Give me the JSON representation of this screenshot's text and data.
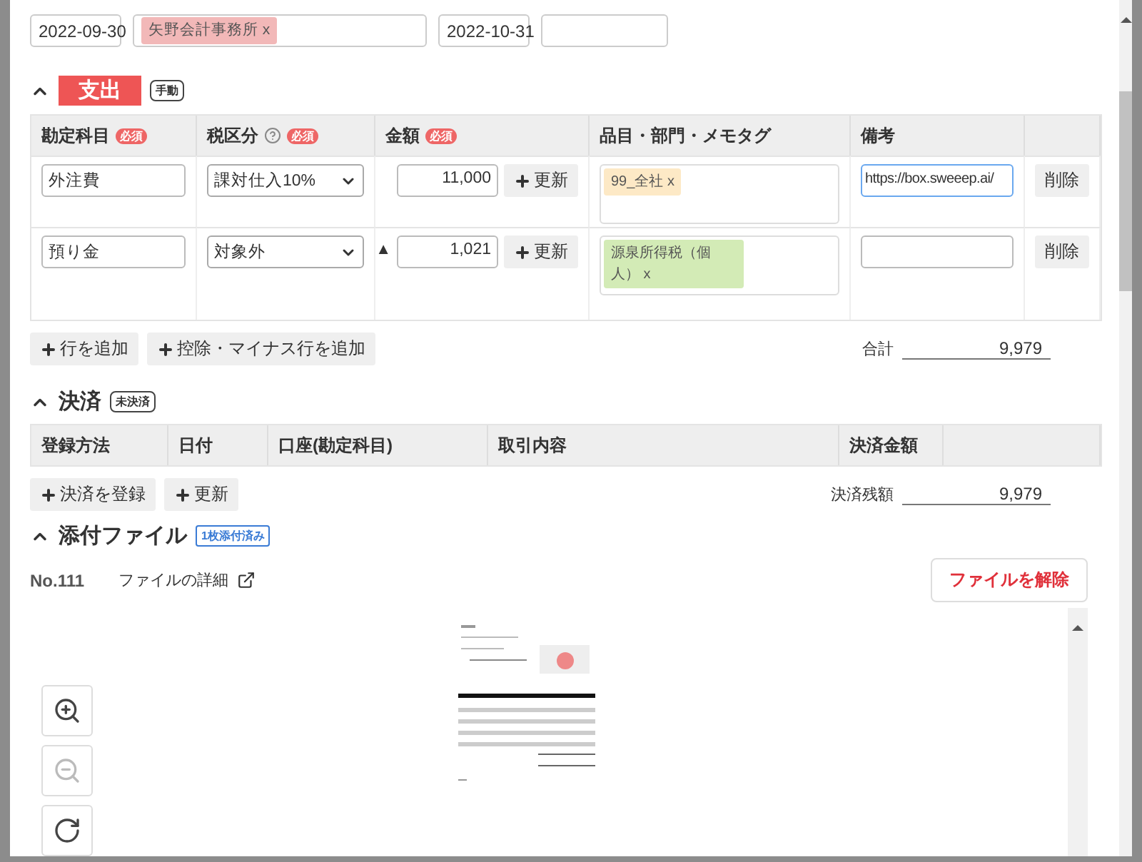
{
  "header": {
    "date_from": "2022-09-30",
    "partner_tags": [
      {
        "label": "矢野会計事務所",
        "remove": "x"
      }
    ],
    "date_to": "2022-10-31"
  },
  "expense": {
    "expanded": true,
    "title": "支出",
    "badge": "手動",
    "columns": [
      {
        "label": "勘定科目",
        "required": "必須",
        "help": false
      },
      {
        "label": "税区分",
        "required": "必須",
        "help": true
      },
      {
        "label": "金額",
        "required": "必須",
        "help": false
      },
      {
        "label": "品目・部門・メモタグ"
      },
      {
        "label": "備考"
      }
    ],
    "rows": [
      {
        "account": "外注費",
        "tax": "課対仕入10%",
        "amount": "11,000",
        "update": "更新",
        "tags": [
          {
            "label": "99_全社",
            "remove": "x",
            "color": "#fde9c6"
          }
        ],
        "note": "https://box.sweeep.ai/",
        "note_focused": true,
        "delete": "削除"
      },
      {
        "account": "預り金",
        "tax": "対象外",
        "sign": "▲",
        "amount": "1,021",
        "update": "更新",
        "tags": [
          {
            "label": "源泉所得税（個人）",
            "remove": "x",
            "color": "#d3ebb6"
          }
        ],
        "note_focused": false,
        "delete": "削除"
      }
    ],
    "buttons": [
      "行を追加",
      "控除・マイナス行を追加"
    ],
    "total_label": "合計",
    "total": "9,979"
  },
  "settlement": {
    "expanded": true,
    "title": "決済",
    "badge": "未決済",
    "columns": [
      "登録方法",
      "日付",
      "口座(勘定科目)",
      "取引内容",
      "決済金額"
    ],
    "buttons": [
      "決済を登録",
      "更新"
    ],
    "balance_label": "決済残額",
    "balance": "9,979"
  },
  "attachment": {
    "expanded": true,
    "title": "添付ファイル",
    "badge": "1枚添付済み",
    "number": "No.111",
    "details_link": "ファイルの詳細",
    "remove_button": "ファイルを解除",
    "zoom_in_disabled": false,
    "zoom_out_disabled": true
  }
}
